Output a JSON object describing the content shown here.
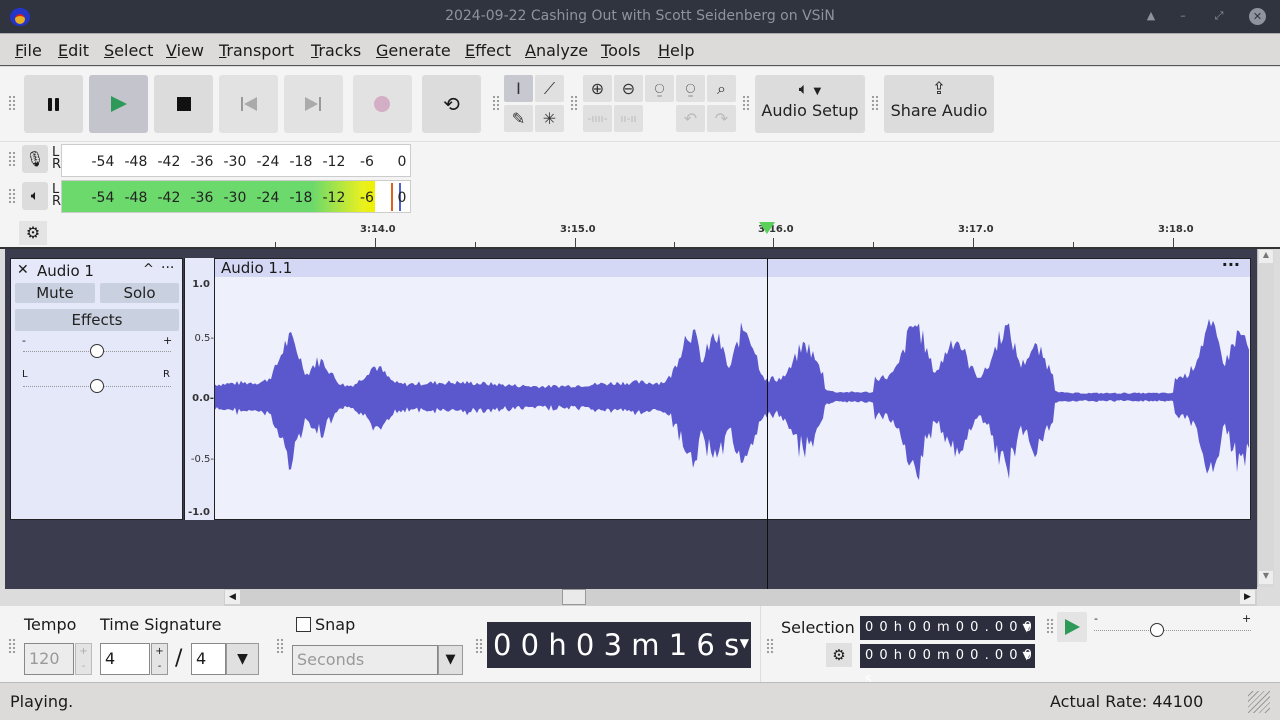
{
  "window": {
    "title": "2024-09-22 Cashing Out with Scott Seidenberg on VSiN",
    "controls": [
      "eject-icon",
      "minimize-icon",
      "maximize-icon",
      "close-icon"
    ]
  },
  "menu": [
    "File",
    "Edit",
    "Select",
    "View",
    "Transport",
    "Tracks",
    "Generate",
    "Effect",
    "Analyze",
    "Tools",
    "Help"
  ],
  "transport": {
    "buttons": [
      {
        "name": "pause",
        "icon": "pause-icon",
        "state": "enabled"
      },
      {
        "name": "play",
        "icon": "play-icon",
        "state": "active"
      },
      {
        "name": "stop",
        "icon": "stop-icon",
        "state": "enabled"
      },
      {
        "name": "skip-start",
        "icon": "skip-start-icon",
        "state": "disabled"
      },
      {
        "name": "skip-end",
        "icon": "skip-end-icon",
        "state": "disabled"
      },
      {
        "name": "record",
        "icon": "record-icon",
        "state": "disabled"
      },
      {
        "name": "loop",
        "icon": "loop-icon",
        "state": "enabled"
      }
    ]
  },
  "tools": {
    "edit": [
      "selection-tool-icon",
      "envelope-tool-icon",
      "draw-tool-icon",
      "multi-tool-icon"
    ],
    "zoom": [
      "zoom-in-icon",
      "zoom-out-icon",
      "fit-selection-icon",
      "fit-project-icon",
      "zoom-toggle-icon"
    ],
    "trim": [
      "trim-outside-icon",
      "silence-icon"
    ],
    "history": [
      "undo-icon",
      "redo-icon"
    ]
  },
  "audio_setup": {
    "label": "Audio Setup",
    "icon": "speaker-icon"
  },
  "share_audio": {
    "label": "Share Audio",
    "icon": "share-icon"
  },
  "meters": {
    "scale": [
      "-54",
      "-48",
      "-42",
      "-36",
      "-30",
      "-24",
      "-18",
      "-12",
      "-6",
      "0"
    ],
    "record": {
      "icon": "microphone-icon",
      "level_db": null
    },
    "playback": {
      "icon": "speaker-icon",
      "level_db": -5,
      "peak_db": -2
    }
  },
  "ruler": {
    "labels": [
      "3:14.0",
      "3:15.0",
      "3:16.0",
      "3:17.0",
      "3:18.0"
    ],
    "playhead": "3:16.0"
  },
  "track": {
    "name": "Audio 1",
    "mute": "Mute",
    "solo": "Solo",
    "effects": "Effects",
    "gain_min": "-",
    "gain_max": "+",
    "pan_left": "L",
    "pan_right": "R",
    "gain_value": 0.5,
    "pan_value": 0.5,
    "clip_name": "Audio 1.1",
    "scale": [
      "1.0",
      "0.5-",
      "0.0-",
      "-0.5-",
      "-1.0"
    ],
    "waveform_color": "#5b57cc"
  },
  "bottom": {
    "tempo_label": "Tempo",
    "tempo_value": "120",
    "timesig_label": "Time Signature",
    "timesig_num": "4",
    "timesig_den": "4",
    "slash": "/",
    "snap_label": "Snap",
    "snap_checked": false,
    "snap_unit": "Seconds",
    "time_display": "0 0 h 0 3 m 1 6 s",
    "selection_label": "Selection",
    "sel_start": "0 0 h 0 0 m 0 0 . 0 0 0 s",
    "sel_end": "0 0 h 0 0 m 0 0 . 0 0 0 s",
    "speed_min": "-",
    "speed_max": "+",
    "speed_value": 0.4
  },
  "status": {
    "left": "Playing.",
    "right": "Actual Rate: 44100"
  }
}
